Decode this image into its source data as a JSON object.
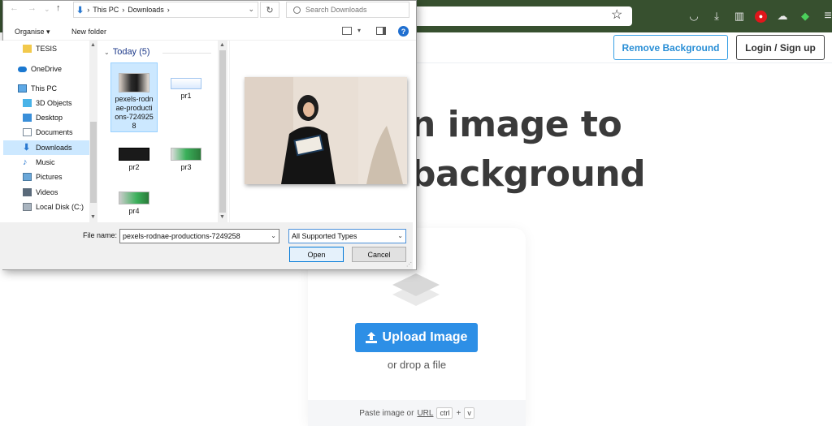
{
  "browser": {
    "accent_bg": "#37502f",
    "icons": [
      "star-icon",
      "pocket-icon",
      "download-icon",
      "library-icon",
      "extension-red-icon",
      "extension-cloud-icon",
      "extension-green-icon",
      "menu-icon"
    ]
  },
  "site": {
    "header": {
      "remove_bg_label": "Remove Background",
      "login_label": "Login / Sign up"
    },
    "hero": {
      "line1": "n image to",
      "line2": "background"
    },
    "upload": {
      "button_label": "Upload Image",
      "drop_text": "or drop a file",
      "paste_prefix": "Paste image or",
      "paste_url": "URL",
      "kbd_ctrl": "ctrl",
      "kbd_plus": "+",
      "kbd_v": "v",
      "accent": "#2d8fe6"
    }
  },
  "dialog": {
    "breadcrumb": {
      "sep": "›",
      "this_pc": "This PC",
      "downloads": "Downloads"
    },
    "search_placeholder": "Search Downloads",
    "toolbar": {
      "organise": "Organise ▾",
      "new_folder": "New folder"
    },
    "nav_items": [
      {
        "label": "TESIS",
        "icon": "folder-icon"
      },
      {
        "label": "OneDrive",
        "icon": "onedrive-icon"
      },
      {
        "label": "This PC",
        "icon": "computer-icon"
      },
      {
        "label": "3D Objects",
        "icon": "3d-objects-icon"
      },
      {
        "label": "Desktop",
        "icon": "desktop-icon"
      },
      {
        "label": "Documents",
        "icon": "documents-icon"
      },
      {
        "label": "Downloads",
        "icon": "downloads-icon"
      },
      {
        "label": "Music",
        "icon": "music-icon"
      },
      {
        "label": "Pictures",
        "icon": "pictures-icon"
      },
      {
        "label": "Videos",
        "icon": "videos-icon"
      },
      {
        "label": "Local Disk (C:)",
        "icon": "disk-icon"
      }
    ],
    "group_header": "Today (5)",
    "files": [
      {
        "label": "pexels-rodnae-productions-7249258"
      },
      {
        "label": "pr1"
      },
      {
        "label": "pr2"
      },
      {
        "label": "pr3"
      },
      {
        "label": "pr4"
      }
    ],
    "file_name_label": "File name:",
    "file_name_value": "pexels-rodnae-productions-7249258",
    "file_type_value": "All Supported Types",
    "open_label": "Open",
    "cancel_label": "Cancel"
  }
}
